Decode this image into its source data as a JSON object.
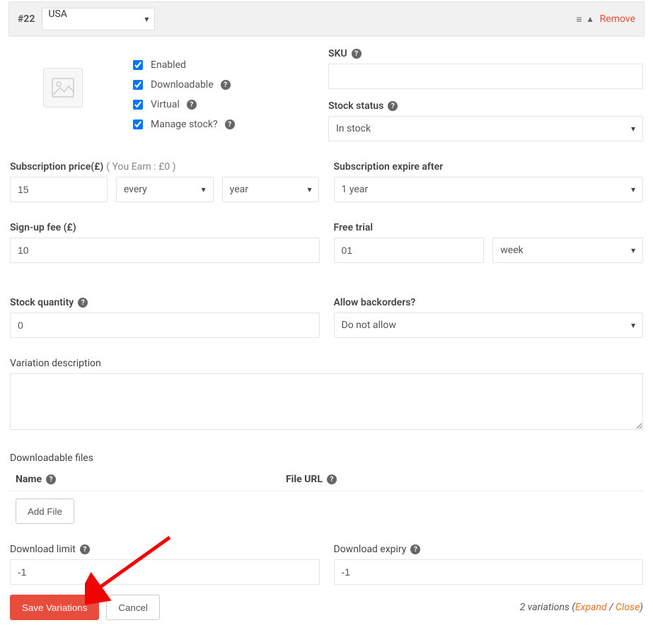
{
  "header": {
    "num": "#22",
    "country": "USA",
    "remove": "Remove"
  },
  "checks": {
    "enabled": "Enabled",
    "downloadable": "Downloadable",
    "virtual": "Virtual",
    "manage_stock": "Manage stock?"
  },
  "sku": {
    "label": "SKU",
    "value": ""
  },
  "stock_status": {
    "label": "Stock status",
    "value": "In stock"
  },
  "price": {
    "label": "Subscription price(£)",
    "hint": "( You Earn : £0 )",
    "value": "15",
    "every": "every",
    "period": "year"
  },
  "expire": {
    "label": "Subscription expire after",
    "value": "1 year"
  },
  "signup": {
    "label": "Sign-up fee (£)",
    "value": "10"
  },
  "trial": {
    "label": "Free trial",
    "value": "01",
    "unit": "week"
  },
  "stock_qty": {
    "label": "Stock quantity",
    "value": "0"
  },
  "backorders": {
    "label": "Allow backorders?",
    "value": "Do not allow"
  },
  "desc": {
    "label": "Variation description",
    "value": ""
  },
  "files": {
    "label": "Downloadable files",
    "col_name": "Name",
    "col_url": "File URL",
    "add_btn": "Add File"
  },
  "dl_limit": {
    "label": "Download limit",
    "value": "-1"
  },
  "dl_expiry": {
    "label": "Download expiry",
    "value": "-1"
  },
  "footer": {
    "save": "Save Variations",
    "cancel": "Cancel",
    "count": "2 variations",
    "expand": "Expand",
    "close": "Close"
  }
}
